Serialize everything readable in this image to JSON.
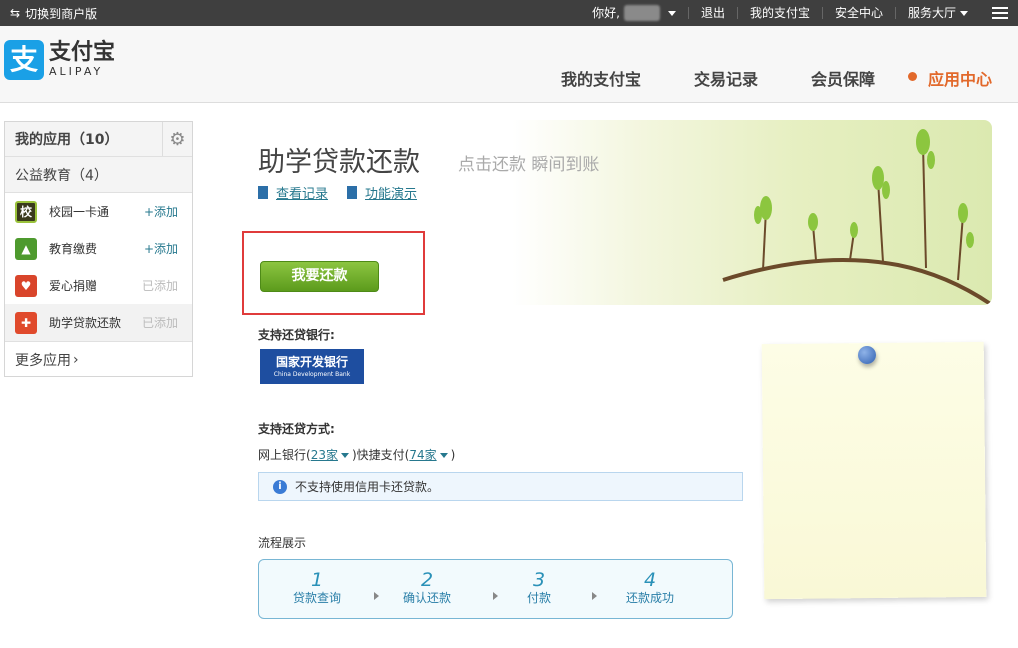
{
  "topbar": {
    "switch_label": "切换到商户版",
    "greeting": "你好,",
    "logout": "退出",
    "my_alipay": "我的支付宝",
    "security": "安全中心",
    "service_hall": "服务大厅"
  },
  "header": {
    "logo_cn": "支付宝",
    "logo_en": "ALIPAY",
    "logo_mark": "支",
    "nav": [
      "我的支付宝",
      "交易记录",
      "会员保障",
      "应用中心"
    ],
    "active_nav": "应用中心",
    "accent_color": "#e2692b"
  },
  "sidebar": {
    "my_apps": "我的应用（10）",
    "category": "公益教育（4）",
    "items": [
      {
        "label": "校园一卡通",
        "action": "+添加",
        "icon": "school-card-icon",
        "icon_text": "校",
        "color": "#3a3a1c"
      },
      {
        "label": "教育缴费",
        "action": "+添加",
        "icon": "graduation-cap-icon",
        "icon_text": "🎓",
        "color": "#4e9a2e"
      },
      {
        "label": "爱心捐赠",
        "action": "已添加",
        "icon": "heart-icon",
        "icon_text": "♥",
        "color": "#d9452b"
      },
      {
        "label": "助学贷款还款",
        "action": "已添加",
        "icon": "loan-icon",
        "icon_text": "✚",
        "color": "#e04a2c"
      }
    ],
    "more": "更多应用"
  },
  "main": {
    "title": "助学贷款还款",
    "subtitle": "点击还款 瞬间到账",
    "link_records": "查看记录",
    "link_demo": "功能演示",
    "pay_button": "我要还款",
    "banks_label": "支持还贷银行:",
    "bank_name_cn": "国家开发银行",
    "bank_name_en": "China Development Bank",
    "methods_label": "支持还贷方式:",
    "methods": {
      "online_prefix": "网上银行(",
      "online_count": "23家",
      "quick_prefix": ")快捷支付(",
      "quick_count": "74家",
      "suffix": ")"
    },
    "notice": "不支持使用信用卡还贷款。",
    "flow_title": "流程展示",
    "steps": [
      {
        "num": "1",
        "label": "贷款查询"
      },
      {
        "num": "2",
        "label": "确认还款"
      },
      {
        "num": "3",
        "label": "付款"
      },
      {
        "num": "4",
        "label": "还款成功"
      }
    ]
  }
}
